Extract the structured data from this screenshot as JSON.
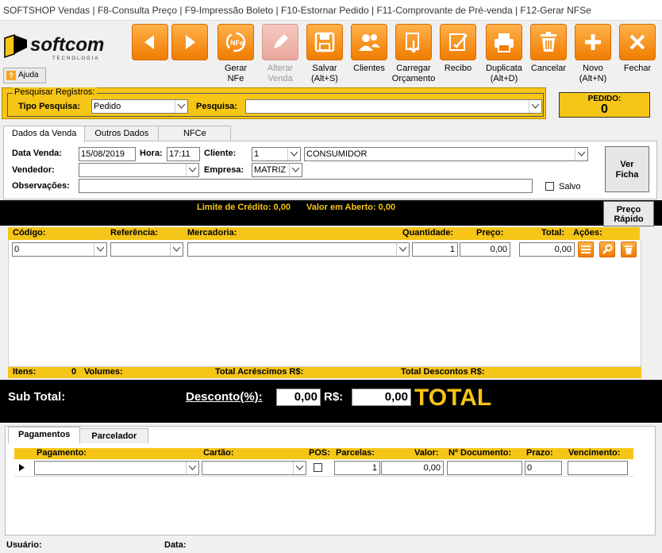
{
  "window": {
    "title": "SOFTSHOP Vendas | F8-Consulta Preço | F9-Impressão Boleto | F10-Estornar Pedido | F11-Comprovante de Pré-venda | F12-Gerar NFSe"
  },
  "logo": {
    "name": "softcom",
    "tagline": "TECNOLOGIA"
  },
  "toolbar": {
    "buttons": [
      {
        "label": "",
        "icon": "arrow-left-icon"
      },
      {
        "label": "",
        "icon": "arrow-right-icon"
      },
      {
        "label": "Gerar\nNFe",
        "icon": "nfe-icon"
      },
      {
        "label": "Alterar\nVenda",
        "icon": "edit-icon"
      },
      {
        "label": "Salvar\n(Alt+S)",
        "icon": "save-icon"
      },
      {
        "label": "Clientes",
        "icon": "clients-icon"
      },
      {
        "label": "Carregar\nOrçamento",
        "icon": "load-budget-icon"
      },
      {
        "label": "Recibo",
        "icon": "receipt-icon"
      },
      {
        "label": "Duplicata\n(Alt+D)",
        "icon": "printer-icon"
      },
      {
        "label": "Cancelar",
        "icon": "trash-icon"
      },
      {
        "label": "Novo\n(Alt+N)",
        "icon": "plus-icon"
      },
      {
        "label": "Fechar",
        "icon": "close-icon"
      }
    ],
    "help_label": "Ajuda"
  },
  "search": {
    "legend": "Pesquisar Registros:",
    "type_label": "Tipo Pesquisa:",
    "type_value": "Pedido",
    "search_label": "Pesquisa:",
    "search_value": ""
  },
  "pedido": {
    "label": "PEDIDO:",
    "value": "0"
  },
  "tabs": [
    "Dados da Venda",
    "Outros Dados",
    "NFCe"
  ],
  "venda": {
    "data_label": "Data Venda:",
    "data_value": "15/08/2019",
    "hora_label": "Hora:",
    "hora_value": "17:11",
    "cliente_label": "Cliente:",
    "cliente_code": "1",
    "cliente_name": "CONSUMIDOR",
    "vendedor_label": "Vendedor:",
    "vendedor_value": "",
    "empresa_label": "Empresa:",
    "empresa_value": "MATRIZ",
    "obs_label": "Observações:",
    "obs_value": "",
    "salvo_label": "Salvo",
    "ver_ficha": "Ver\nFicha"
  },
  "credit": {
    "limite": "Limite de Crédito: 0,00",
    "aberto": "Valor em Aberto: 0,00",
    "preco_rapido": "Preço\nRápido"
  },
  "items_grid": {
    "headers": [
      "Código:",
      "Referência:",
      "Mercadoria:",
      "Quantidade:",
      "Preço:",
      "Total:",
      "Ações:"
    ],
    "row": {
      "codigo": "0",
      "referencia": "",
      "mercadoria": "",
      "quantidade": "1",
      "preco": "0,00",
      "total": "0,00"
    }
  },
  "totals": {
    "itens_label": "Itens:",
    "itens_value": "0",
    "volumes_label": "Volumes:",
    "acrescimos_label": "Total Acréscimos R$:",
    "descontos_label": "Total Descontos R$:"
  },
  "subtotal": {
    "label": "Sub Total:",
    "desconto_label": "Desconto(%):",
    "desconto_pct": "0,00",
    "rs_label": "R$:",
    "desconto_rs": "0,00",
    "total_label": "TOTAL"
  },
  "pag_tabs": [
    "Pagamentos",
    "Parcelador"
  ],
  "pag_grid": {
    "headers": [
      "Pagamento:",
      "Cartão:",
      "POS:",
      "Parcelas:",
      "Valor:",
      "Nº Documento:",
      "Prazo:",
      "Vencimento:"
    ],
    "row": {
      "pagamento": "",
      "cartao": "",
      "parcelas": "1",
      "valor": "0,00",
      "documento": "",
      "prazo": "0",
      "vencimento": ""
    }
  },
  "status": {
    "usuario_label": "Usuário:",
    "data_label": "Data:"
  },
  "colors": {
    "accent_yellow": "#f5c518",
    "orange": "#f07c00",
    "black": "#000000"
  }
}
